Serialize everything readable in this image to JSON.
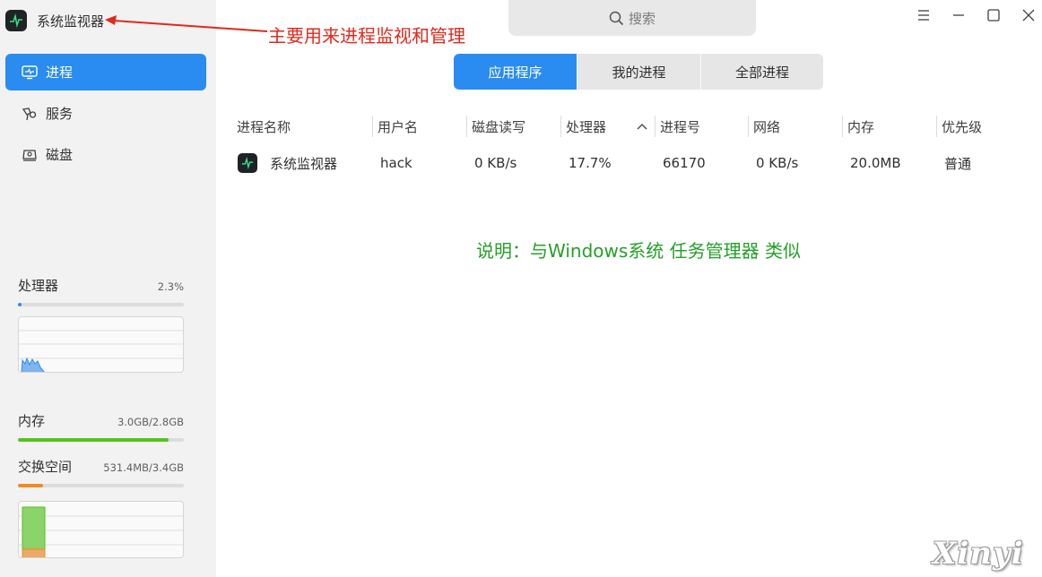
{
  "app": {
    "title": "系统监视器",
    "logo_icon": "monitor-pulse-icon"
  },
  "annotations": {
    "red_note": "主要用来进程监视和管理",
    "green_note": "说明：与Windows系统 任务管理器 类似",
    "red_color": "#e0291c",
    "green_color": "#24a028"
  },
  "sidebar": {
    "items": [
      {
        "label": "进程",
        "icon": "process-icon",
        "active": true
      },
      {
        "label": "服务",
        "icon": "service-icon",
        "active": false
      },
      {
        "label": "磁盘",
        "icon": "disk-icon",
        "active": false
      }
    ],
    "cpu": {
      "label": "处理器",
      "value": "2.3%",
      "fraction": 0.023,
      "color": "#2a8cf0"
    },
    "memory": {
      "label": "内存",
      "value": "3.0GB/2.8GB",
      "fraction": 0.91,
      "color": "#52c41a"
    },
    "swap": {
      "label": "交换空间",
      "value": "531.4MB/3.4GB",
      "fraction": 0.15,
      "color": "#f08a24"
    }
  },
  "search": {
    "placeholder": "搜索",
    "icon": "search-icon"
  },
  "window_controls": [
    {
      "name": "menu-icon"
    },
    {
      "name": "minimize-icon"
    },
    {
      "name": "maximize-icon"
    },
    {
      "name": "close-icon"
    }
  ],
  "tabs": [
    {
      "label": "应用程序",
      "active": true
    },
    {
      "label": "我的进程",
      "active": false
    },
    {
      "label": "全部进程",
      "active": false
    }
  ],
  "table": {
    "columns": [
      "进程名称",
      "用户名",
      "磁盘读写",
      "处理器",
      "进程号",
      "网络",
      "内存",
      "优先级"
    ],
    "sort_column": "处理器",
    "sort_icon": "chevron-up-icon",
    "rows": [
      {
        "name": "系统监视器",
        "user": "hack",
        "disk": "0 KB/s",
        "cpu": "17.7%",
        "pid": "66170",
        "net": "0 KB/s",
        "mem": "20.0MB",
        "priority": "普通"
      }
    ]
  },
  "watermark": "Xinyi",
  "accent_color": "#2a8cf0"
}
